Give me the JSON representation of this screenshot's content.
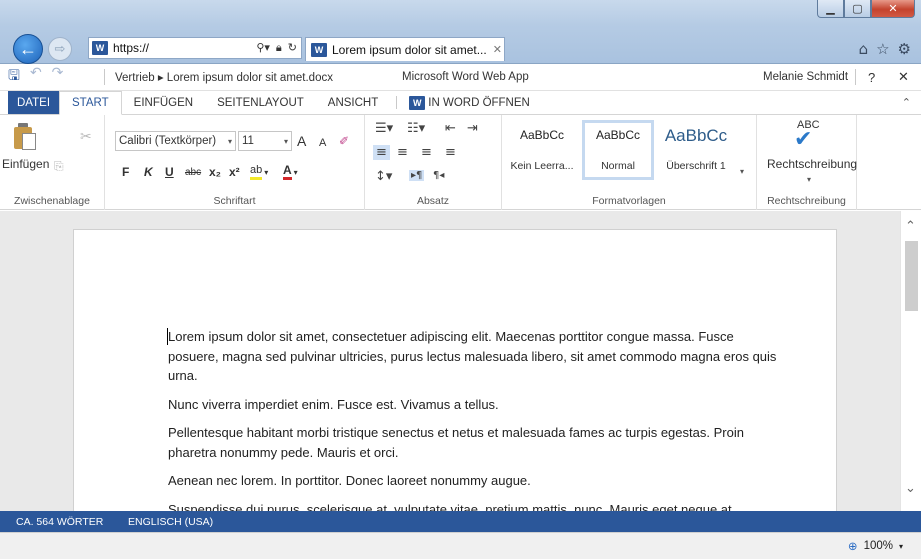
{
  "browser": {
    "address_url": "https://",
    "tab_title": "Lorem ipsum dolor sit amet...",
    "icons": [
      "back-icon",
      "forward-icon",
      "search-icon",
      "lock-icon",
      "refresh-icon",
      "home-icon",
      "favorites-star-icon",
      "settings-gear-icon"
    ]
  },
  "titlebar": {
    "breadcrumb": "Vertrieb ▸ Lorem ipsum dolor sit amet.docx",
    "app_name": "Microsoft Word Web App",
    "user_name": "Melanie Schmidt",
    "help": "?",
    "close": "✕"
  },
  "ribbon_tabs": {
    "file": "DATEI",
    "start": "START",
    "insert": "EINFÜGEN",
    "layout": "SEITENLAYOUT",
    "view": "ANSICHT",
    "open_in_word": "IN WORD ÖFFNEN"
  },
  "ribbon": {
    "clipboard": {
      "paste": "Einfügen",
      "label": "Zwischenablage"
    },
    "font": {
      "family": "Calibri (Textkörper)",
      "size": "11",
      "grow": "A",
      "shrink": "A",
      "bold": "F",
      "italic": "K",
      "underline": "U",
      "strikethrough": "abc",
      "subscript": "x₂",
      "superscript": "x²",
      "highlight": "ab",
      "font_color": "A",
      "label": "Schriftart"
    },
    "paragraph": {
      "label": "Absatz"
    },
    "styles": {
      "items": [
        {
          "sample": "AaBbCc",
          "name": "Kein Leerra..."
        },
        {
          "sample": "AaBbCc",
          "name": "Normal"
        },
        {
          "sample": "AaBbCc",
          "name": "Überschrift 1"
        }
      ],
      "label": "Formatvorlagen"
    },
    "spelling": {
      "abc": "ABC",
      "button": "Rechtschreibung",
      "label": "Rechtschreibung"
    }
  },
  "document": {
    "paragraphs": [
      "Lorem ipsum dolor sit amet, consectetuer adipiscing elit. Maecenas porttitor congue massa. Fusce posuere, magna sed pulvinar ultricies, purus lectus malesuada libero, sit amet commodo magna eros quis urna.",
      "Nunc viverra imperdiet enim. Fusce est. Vivamus a tellus.",
      "Pellentesque habitant morbi tristique senectus et netus et malesuada fames ac turpis egestas. Proin pharetra nonummy pede. Mauris et orci.",
      "Aenean nec lorem. In porttitor. Donec laoreet nonummy augue.",
      "Suspendisse dui purus, scelerisque at, vulputate vitae, pretium mattis, nunc. Mauris eget neque at"
    ]
  },
  "statusbar": {
    "word_count": "CA. 564 WÖRTER",
    "language": "ENGLISCH (USA)"
  },
  "ie_bottom": {
    "zoom": "100%"
  },
  "colors": {
    "word_blue": "#2b579a",
    "ie_blue": "#1d62b9"
  }
}
